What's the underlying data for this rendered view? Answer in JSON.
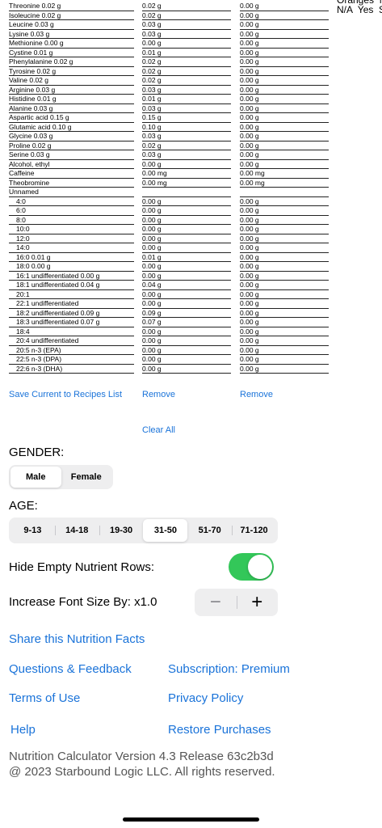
{
  "top_right": "Oranges  N\nN/A  Yes  S",
  "nutrients": [
    {
      "name": "Threonine 0.02 g",
      "v1": "0.02 g",
      "v2": "0.00 g",
      "line": true
    },
    {
      "name": "Isoleucine 0.02 g",
      "v1": "0.02 g",
      "v2": "0.00 g",
      "line": true
    },
    {
      "name": "Leucine 0.03 g",
      "v1": "0.03 g",
      "v2": "0.00 g",
      "line": true
    },
    {
      "name": "Lysine 0.03 g",
      "v1": "0.03 g",
      "v2": "0.00 g",
      "line": true
    },
    {
      "name": "Methionine 0.00 g",
      "v1": "0.00 g",
      "v2": "0.00 g",
      "line": true
    },
    {
      "name": "Cystine 0.01 g",
      "v1": "0.01 g",
      "v2": "0.00 g",
      "line": true
    },
    {
      "name": "Phenylalanine 0.02 g",
      "v1": "0.02 g",
      "v2": "0.00 g",
      "line": true
    },
    {
      "name": "Tyrosine 0.02 g",
      "v1": "0.02 g",
      "v2": "0.00 g",
      "line": true
    },
    {
      "name": "Valine 0.02 g",
      "v1": "0.02 g",
      "v2": "0.00 g",
      "line": true
    },
    {
      "name": "Arginine 0.03 g",
      "v1": "0.03 g",
      "v2": "0.00 g",
      "line": true
    },
    {
      "name": "Histidine 0.01 g",
      "v1": "0.01 g",
      "v2": "0.00 g",
      "line": true
    },
    {
      "name": "Alanine 0.03 g",
      "v1": "0.03 g",
      "v2": "0.00 g",
      "line": true
    },
    {
      "name": "Aspartic acid 0.15 g",
      "v1": "0.15 g",
      "v2": "0.00 g",
      "line": true
    },
    {
      "name": "Glutamic acid 0.10 g",
      "v1": "0.10 g",
      "v2": "0.00 g",
      "line": true
    },
    {
      "name": "Glycine 0.03 g",
      "v1": "0.03 g",
      "v2": "0.00 g",
      "line": true
    },
    {
      "name": "Proline 0.02 g",
      "v1": "0.02 g",
      "v2": "0.00 g",
      "line": true
    },
    {
      "name": "Serine 0.03 g",
      "v1": "0.03 g",
      "v2": "0.00 g",
      "line": true
    },
    {
      "name": "Alcohol, ethyl",
      "v1": "0.00 g",
      "v2": "0.00 g",
      "line": true
    },
    {
      "name": "Caffeine",
      "v1": "0.00 mg",
      "v2": "0.00 mg",
      "line": true
    },
    {
      "name": "Theobromine",
      "v1": "0.00 mg",
      "v2": "0.00 mg",
      "line": true
    },
    {
      "name": "Unnamed",
      "v1": "",
      "v2": "",
      "line": true
    },
    {
      "name": "4:0",
      "v1": "0.00 g",
      "v2": "0.00 g",
      "line": true,
      "sub": true
    },
    {
      "name": "6:0",
      "v1": "0.00 g",
      "v2": "0.00 g",
      "line": true,
      "sub": true
    },
    {
      "name": "8:0",
      "v1": "0.00 g",
      "v2": "0.00 g",
      "line": true,
      "sub": true
    },
    {
      "name": "10:0",
      "v1": "0.00 g",
      "v2": "0.00 g",
      "line": true,
      "sub": true
    },
    {
      "name": "12:0",
      "v1": "0.00 g",
      "v2": "0.00 g",
      "line": true,
      "sub": true
    },
    {
      "name": "14:0",
      "v1": "0.00 g",
      "v2": "0.00 g",
      "line": true,
      "sub": true
    },
    {
      "name": "16:0 0.01 g",
      "v1": "0.01 g",
      "v2": "0.00 g",
      "line": true,
      "sub": true
    },
    {
      "name": "18:0 0.00 g",
      "v1": "0.00 g",
      "v2": "0.00 g",
      "line": true,
      "sub": true
    },
    {
      "name": "16:1 undifferentiated 0.00 g",
      "v1": "0.00 g",
      "v2": "0.00 g",
      "line": true,
      "sub": true
    },
    {
      "name": "18:1 undifferentiated 0.04 g",
      "v1": "0.04 g",
      "v2": "0.00 g",
      "line": true,
      "sub": true
    },
    {
      "name": "20:1",
      "v1": "0.00 g",
      "v2": "0.00 g",
      "line": true,
      "sub": true
    },
    {
      "name": "22:1 undifferentiated",
      "v1": "0.00 g",
      "v2": "0.00 g",
      "line": true,
      "sub": true
    },
    {
      "name": "18:2 undifferentiated 0.09 g",
      "v1": "0.09 g",
      "v2": "0.00 g",
      "line": true,
      "sub": true
    },
    {
      "name": "18:3 undifferentiated 0.07 g",
      "v1": "0.07 g",
      "v2": "0.00 g",
      "line": true,
      "sub": true
    },
    {
      "name": "18:4",
      "v1": "0.00 g",
      "v2": "0.00 g",
      "line": true,
      "sub": true
    },
    {
      "name": "20:4 undifferentiated",
      "v1": "0.00 g",
      "v2": "0.00 g",
      "line": true,
      "sub": true
    },
    {
      "name": "20:5 n-3 (EPA)",
      "v1": "0.00 g",
      "v2": "0.00 g",
      "line": true,
      "sub": true
    },
    {
      "name": "22:5 n-3 (DPA)",
      "v1": "0.00 g",
      "v2": "0.00 g",
      "line": true,
      "sub": true
    },
    {
      "name": "22:6 n-3 (DHA)",
      "v1": "0.00 g",
      "v2": "0.00 g",
      "line": true,
      "sub": true
    }
  ],
  "actions": {
    "save_recipe": "Save Current to Recipes List",
    "remove_1": "Remove",
    "remove_2": "Remove",
    "clear_all": "Clear All"
  },
  "gender": {
    "label": "GENDER:",
    "options": [
      "Male",
      "Female"
    ],
    "selected": "Male"
  },
  "age": {
    "label": "AGE:",
    "options": [
      "9-13",
      "14-18",
      "19-30",
      "31-50",
      "51-70",
      "71-120"
    ],
    "selected": "31-50"
  },
  "settings": {
    "hide_empty_label": "Hide Empty Nutrient Rows:",
    "hide_empty_on": true,
    "font_size_label": "Increase Font Size By: x1.0",
    "minus": "−",
    "plus": "+"
  },
  "links": {
    "share": "Share this Nutrition Facts",
    "questions": "Questions & Feedback",
    "subscription": "Subscription: Premium",
    "terms": "Terms of Use",
    "privacy": "Privacy Policy",
    "help": "Help",
    "restore": "Restore Purchases"
  },
  "footer": {
    "version": "Nutrition Calculator Version 4.3 Release 63c2b3d",
    "copyright": "@ 2023 Starbound Logic LLC. All rights reserved."
  },
  "colors": {
    "link_blue": "#1a73d9",
    "toggle_green": "#33c759",
    "segment_bg": "#eeeeef"
  }
}
